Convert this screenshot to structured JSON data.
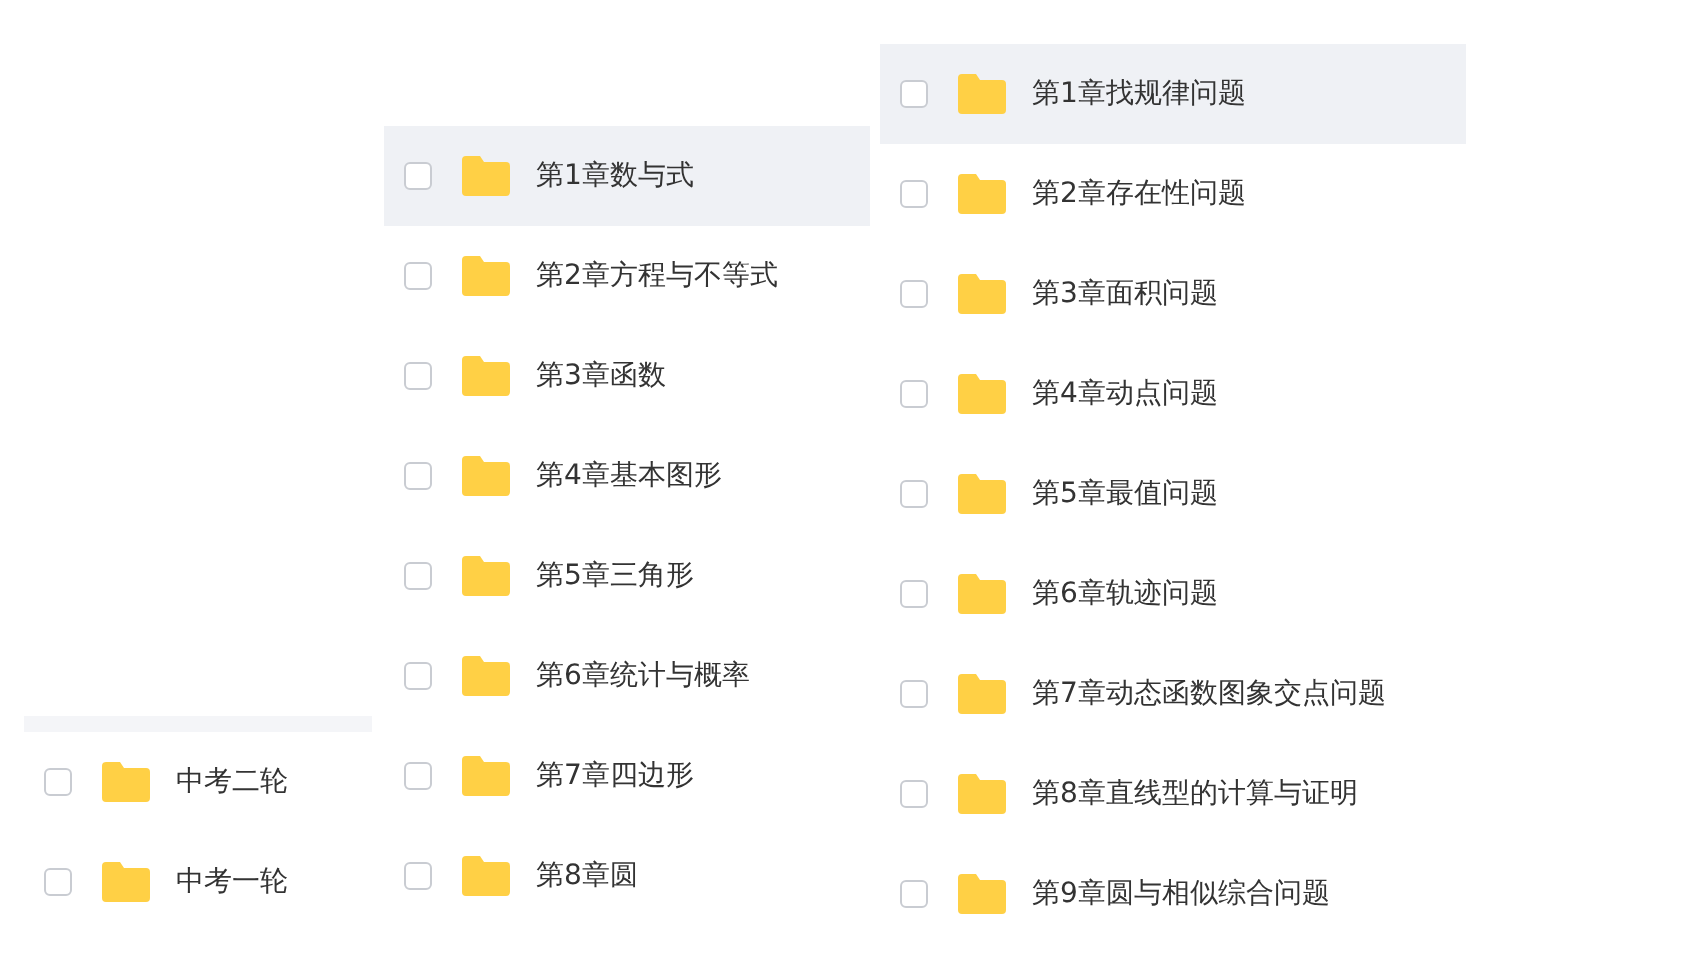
{
  "columns": [
    {
      "items": [
        {
          "name": "中考二轮",
          "selected": false,
          "checked": false
        },
        {
          "name": "中考一轮",
          "selected": false,
          "checked": false
        }
      ]
    },
    {
      "items": [
        {
          "name": "第1章数与式",
          "selected": true,
          "checked": false
        },
        {
          "name": "第2章方程与不等式",
          "selected": false,
          "checked": false
        },
        {
          "name": "第3章函数",
          "selected": false,
          "checked": false
        },
        {
          "name": "第4章基本图形",
          "selected": false,
          "checked": false
        },
        {
          "name": "第5章三角形",
          "selected": false,
          "checked": false
        },
        {
          "name": "第6章统计与概率",
          "selected": false,
          "checked": false
        },
        {
          "name": "第7章四边形",
          "selected": false,
          "checked": false
        },
        {
          "name": "第8章圆",
          "selected": false,
          "checked": false
        }
      ]
    },
    {
      "items": [
        {
          "name": "第1章找规律问题",
          "selected": true,
          "checked": false
        },
        {
          "name": "第2章存在性问题",
          "selected": false,
          "checked": false
        },
        {
          "name": "第3章面积问题",
          "selected": false,
          "checked": false
        },
        {
          "name": "第4章动点问题",
          "selected": false,
          "checked": false
        },
        {
          "name": "第5章最值问题",
          "selected": false,
          "checked": false
        },
        {
          "name": "第6章轨迹问题",
          "selected": false,
          "checked": false
        },
        {
          "name": "第7章动态函数图象交点问题",
          "selected": false,
          "checked": false
        },
        {
          "name": "第8章直线型的计算与证明",
          "selected": false,
          "checked": false
        },
        {
          "name": "第9章圆与相似综合问题",
          "selected": false,
          "checked": false
        }
      ]
    }
  ]
}
